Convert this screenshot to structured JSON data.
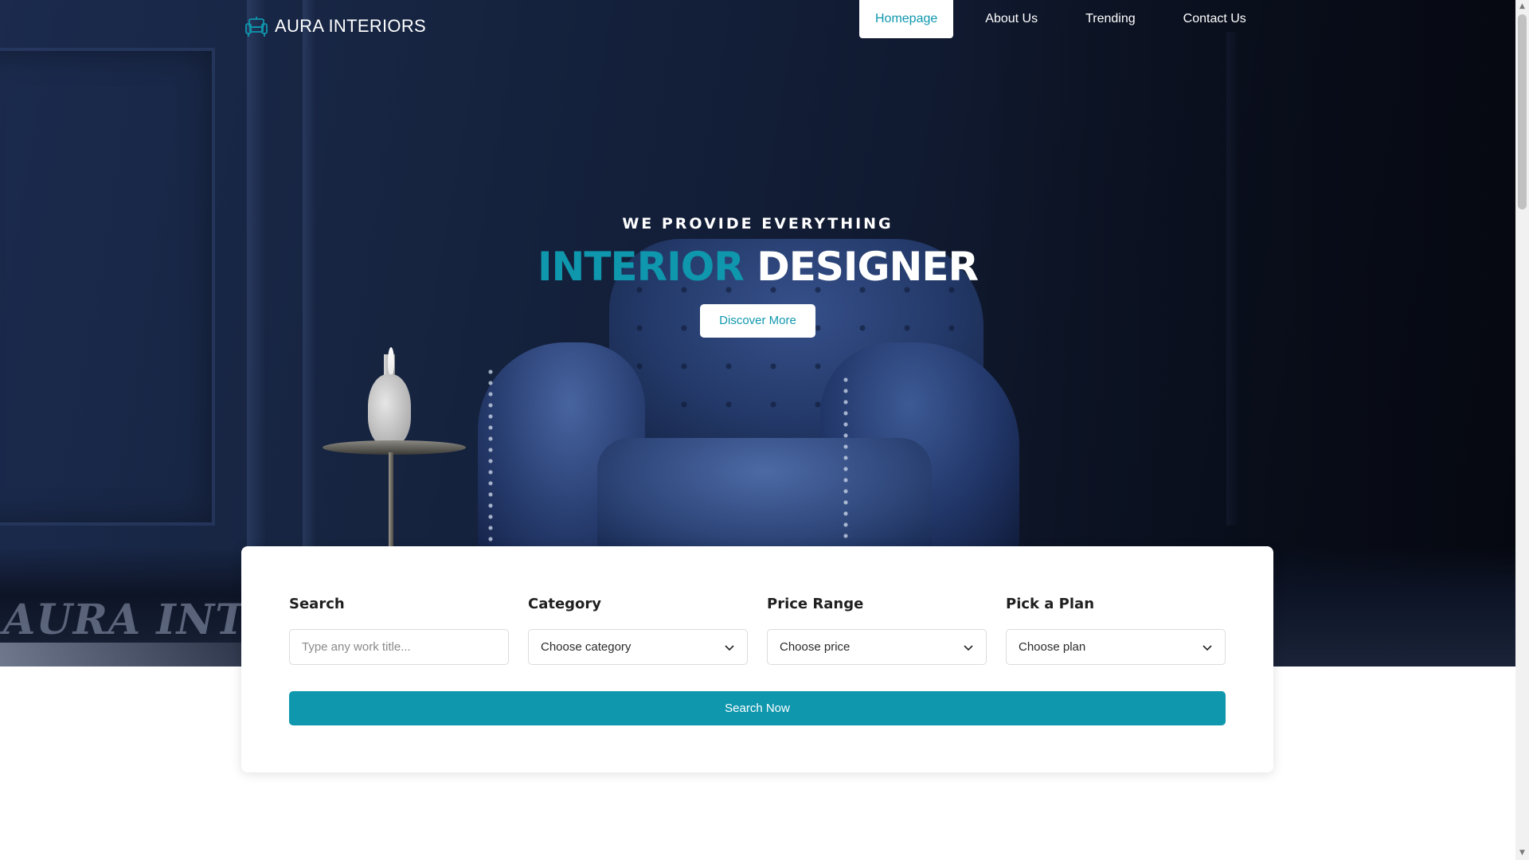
{
  "brand": {
    "name": "AURA INTERIORS",
    "icon": "sofa-icon"
  },
  "nav": {
    "items": [
      {
        "label": "Homepage",
        "active": true
      },
      {
        "label": "About Us",
        "active": false
      },
      {
        "label": "Trending",
        "active": false
      },
      {
        "label": "Contact Us",
        "active": false
      }
    ]
  },
  "hero": {
    "eyebrow": "WE PROVIDE EVERYTHING",
    "headline_accent": "INTERIOR",
    "headline_rest": "DESIGNER",
    "cta_label": "Discover More",
    "watermark": "AURA INTER"
  },
  "search_form": {
    "search": {
      "label": "Search",
      "placeholder": "Type any work title..."
    },
    "category": {
      "label": "Category",
      "selected": "Choose category"
    },
    "price": {
      "label": "Price Range",
      "selected": "Choose price"
    },
    "plan": {
      "label": "Pick a Plan",
      "selected": "Choose plan"
    },
    "submit_label": "Search Now"
  },
  "colors": {
    "accent": "#0f97ae",
    "hero_bg": "#141f3a",
    "white": "#ffffff"
  }
}
